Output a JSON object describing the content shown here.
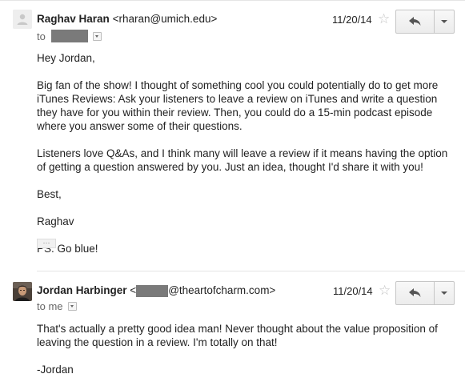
{
  "messages": [
    {
      "sender_name": "Raghav Haran",
      "sender_email": "<rharan@umich.edu>",
      "to_label": "to",
      "date": "11/20/14",
      "body": [
        "Hey Jordan,",
        "Big fan of the show! I thought of something cool you could potentially do to get more iTunes Reviews: Ask your listeners to leave a review on iTunes and write a question they have for you within their review. Then, you could do a 15-min podcast episode where you answer some of their questions.",
        "Listeners love Q&As, and I think many will leave a review if it means having the option of getting a question answered by you. Just an idea, thought I'd share it with you!",
        "Best,",
        "Raghav",
        "PS. Go blue!"
      ],
      "ellipsis": "···"
    },
    {
      "sender_name": "Jordan Harbinger",
      "sender_email_prefix": "<",
      "sender_email_domain": "@theartofcharm.com>",
      "to_label": "to me",
      "date": "11/20/14",
      "body": [
        "That's actually a pretty good idea man!  Never thought about the value proposition of leaving the question in a review.  I'm totally on that!",
        "-Jordan"
      ]
    }
  ],
  "icons": {
    "star": "☆",
    "reply": "reply-arrow",
    "more": "caret-down",
    "avatar_default": "person-silhouette"
  },
  "colors": {
    "redaction": "#7a7a7a",
    "star": "#c4c4c4"
  }
}
